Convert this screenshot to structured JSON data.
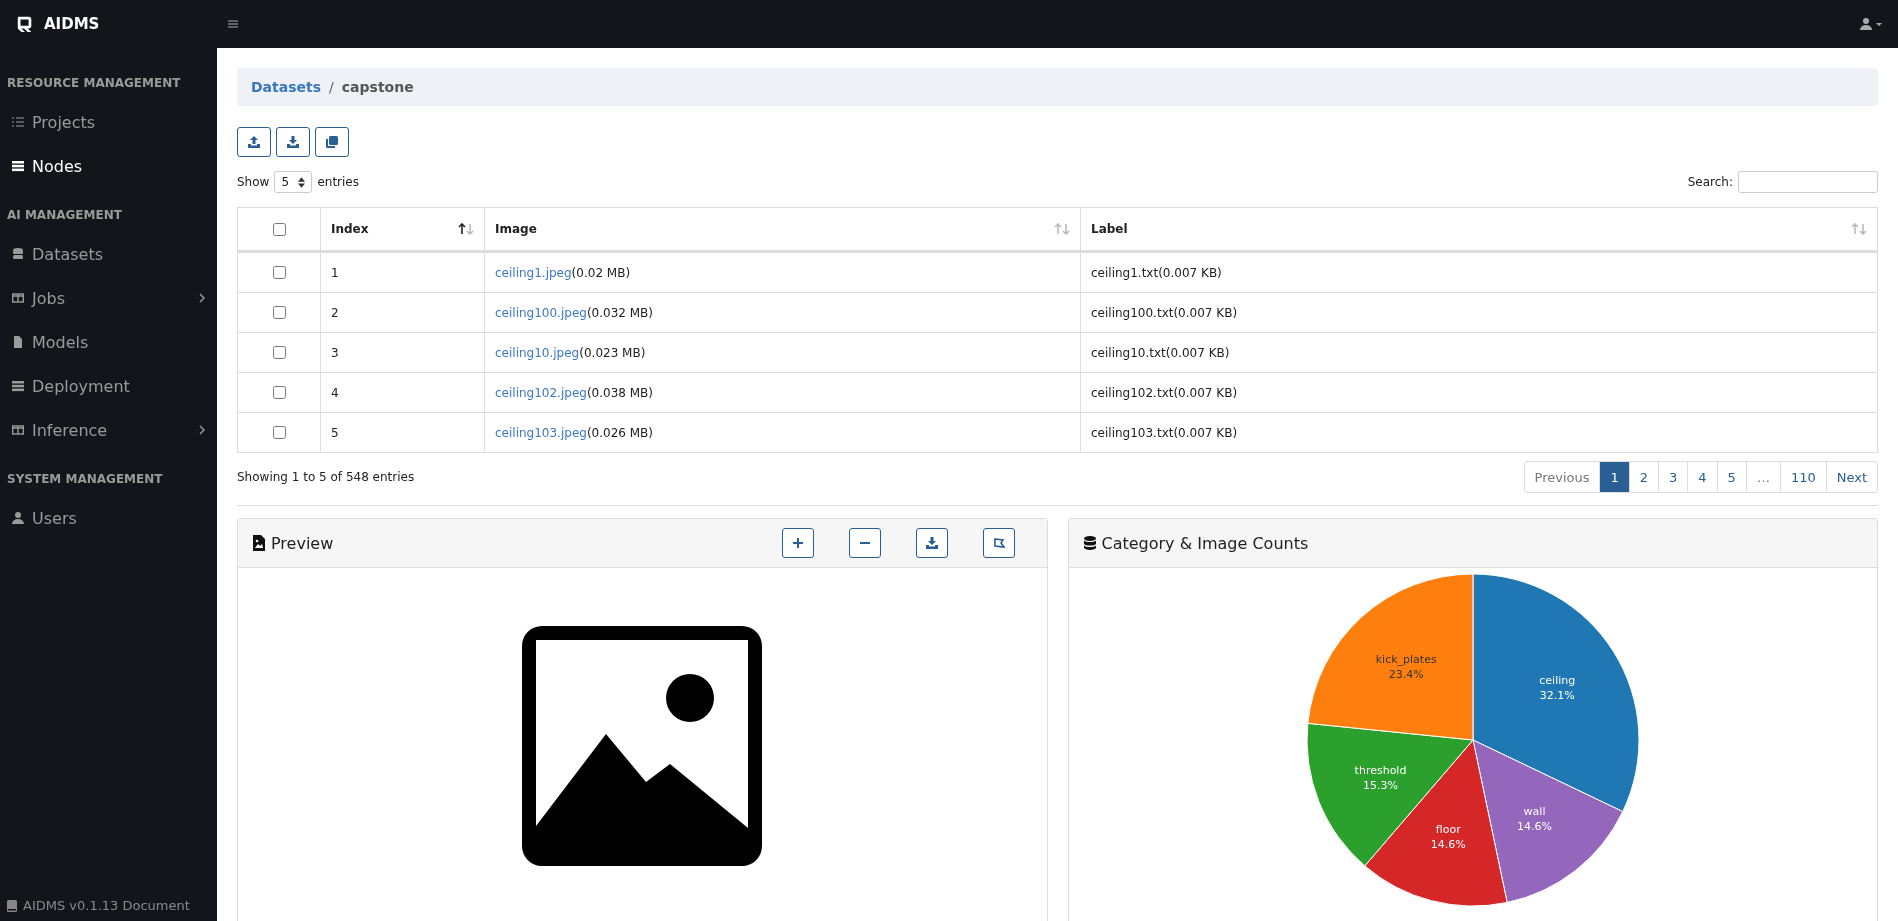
{
  "brand": "AIDMS",
  "sidebar": {
    "sections": [
      {
        "title": "RESOURCE MANAGEMENT",
        "items": [
          {
            "label": "Projects",
            "kind": "list",
            "selected": false,
            "expandable": false
          },
          {
            "label": "Nodes",
            "kind": "bars",
            "selected": true,
            "expandable": false
          }
        ]
      },
      {
        "title": "AI MANAGEMENT",
        "items": [
          {
            "label": "Datasets",
            "kind": "database",
            "selected": false,
            "expandable": false
          },
          {
            "label": "Jobs",
            "kind": "columns",
            "selected": false,
            "expandable": true
          },
          {
            "label": "Models",
            "kind": "file",
            "selected": false,
            "expandable": false
          },
          {
            "label": "Deployment",
            "kind": "bars",
            "selected": false,
            "expandable": false
          },
          {
            "label": "Inference",
            "kind": "columns",
            "selected": false,
            "expandable": true
          }
        ]
      },
      {
        "title": "SYSTEM MANAGEMENT",
        "items": [
          {
            "label": "Users",
            "kind": "user",
            "selected": false,
            "expandable": false
          }
        ]
      }
    ],
    "footer": "AIDMS v0.1.13 Document"
  },
  "breadcrumb": {
    "link": "Datasets",
    "separator": "/",
    "current": "capstone"
  },
  "length_menu": {
    "before": "Show",
    "value": "5",
    "after": "entries"
  },
  "search": {
    "label": "Search:"
  },
  "table": {
    "all_checked": false,
    "columns": [
      {
        "label": "Index",
        "sorted": true
      },
      {
        "label": "Image",
        "sorted": false
      },
      {
        "label": "Label",
        "sorted": false
      }
    ],
    "rows": [
      {
        "checked": false,
        "index": "1",
        "image": "ceiling1.jpeg",
        "size": "(0.02 MB)",
        "label": "ceiling1.txt(0.007 KB)"
      },
      {
        "checked": false,
        "index": "2",
        "image": "ceiling100.jpeg",
        "size": "(0.032 MB)",
        "label": "ceiling100.txt(0.007 KB)"
      },
      {
        "checked": false,
        "index": "3",
        "image": "ceiling10.jpeg",
        "size": "(0.023 MB)",
        "label": "ceiling10.txt(0.007 KB)"
      },
      {
        "checked": false,
        "index": "4",
        "image": "ceiling102.jpeg",
        "size": "(0.038 MB)",
        "label": "ceiling102.txt(0.007 KB)"
      },
      {
        "checked": false,
        "index": "5",
        "image": "ceiling103.jpeg",
        "size": "(0.026 MB)",
        "label": "ceiling103.txt(0.007 KB)"
      }
    ]
  },
  "info": "Showing 1 to 5 of 548 entries",
  "pagination": [
    {
      "label": "Previous",
      "selected": false
    },
    {
      "label": "1",
      "selected": true
    },
    {
      "label": "2",
      "selected": false
    },
    {
      "label": "3",
      "selected": false
    },
    {
      "label": "4",
      "selected": false
    },
    {
      "label": "5",
      "selected": false
    },
    {
      "label": "…",
      "selected": false
    },
    {
      "label": "110",
      "selected": false
    },
    {
      "label": "Next",
      "selected": false
    }
  ],
  "preview": {
    "title": "Preview"
  },
  "counts": {
    "title": "Category & Image Counts",
    "chart_data": {
      "type": "pie",
      "categories": [
        "ceiling",
        "wall",
        "floor",
        "threshold",
        "kick_plates"
      ],
      "values": [
        32.1,
        14.6,
        14.6,
        15.3,
        23.4
      ],
      "colors": [
        "#1f77b4",
        "#9467bd",
        "#d62728",
        "#2ca02c",
        "#ff7f0e"
      ],
      "value_labels": [
        "32.1%",
        "14.6%",
        "14.6%",
        "15.3%",
        "23.4%"
      ]
    }
  }
}
